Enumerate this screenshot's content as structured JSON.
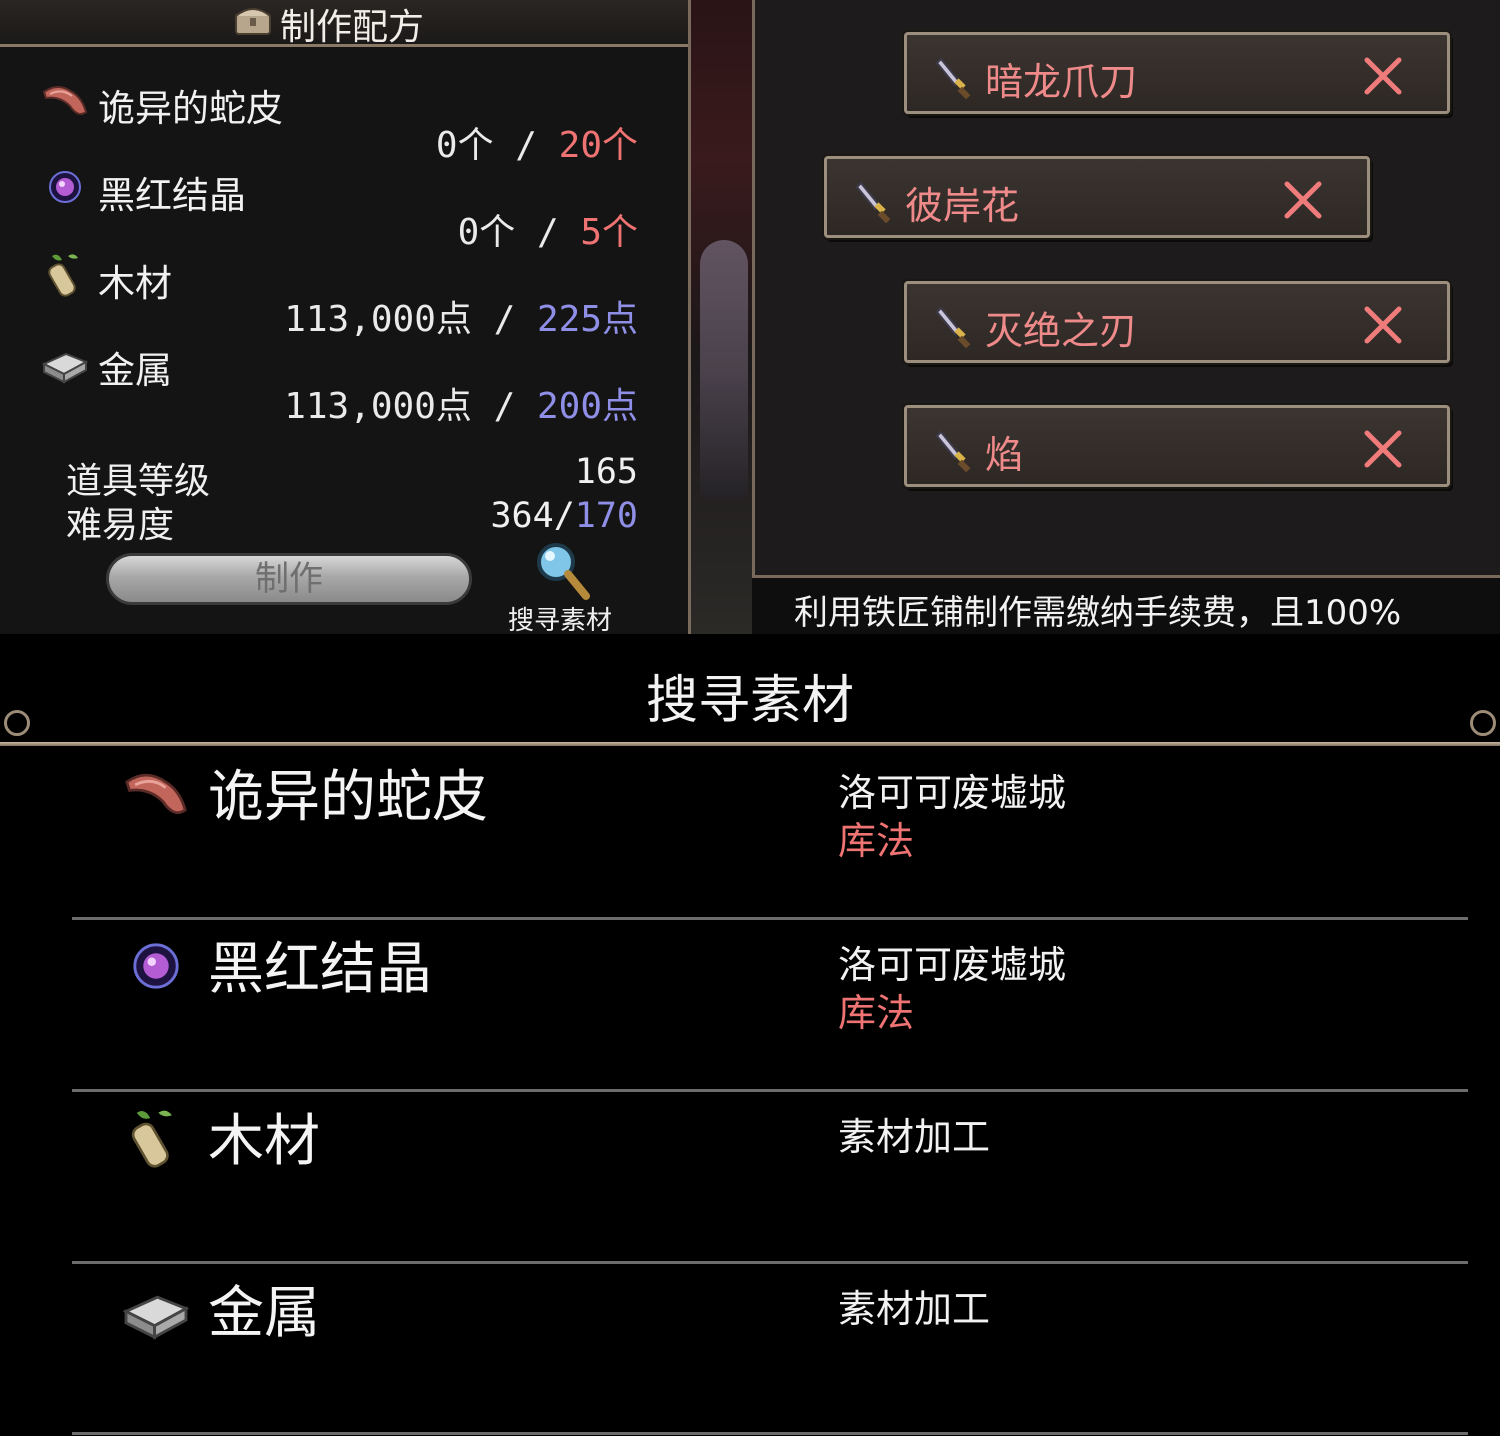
{
  "recipe": {
    "title": "制作配方",
    "materials": [
      {
        "name": "诡异的蛇皮",
        "icon": "snake-skin-icon",
        "have": "0个",
        "sep": "/",
        "need": "20个",
        "need_color": "#ef7373"
      },
      {
        "name": "黑红结晶",
        "icon": "crystal-icon",
        "have": "0个",
        "sep": "/",
        "need": "5个",
        "need_color": "#ef7373"
      },
      {
        "name": "木材",
        "icon": "wood-icon",
        "have": "113,000点",
        "sep": "/",
        "need": "225点",
        "need_color": "#8f8fe8"
      },
      {
        "name": "金属",
        "icon": "metal-icon",
        "have": "113,000点",
        "sep": "/",
        "need": "200点",
        "need_color": "#8f8fe8"
      }
    ],
    "item_level_label": "道具等级",
    "item_level_value": "165",
    "difficulty_label": "难易度",
    "difficulty_have": "364/",
    "difficulty_need": "170",
    "make_button": "制作",
    "search_link": "搜寻素材"
  },
  "weapons": [
    {
      "name": "暗龙爪刀"
    },
    {
      "name": "彼岸花"
    },
    {
      "name": "灭绝之刃"
    },
    {
      "name": "焰"
    }
  ],
  "notice": "利用铁匠铺制作需缴纳手续费，且100%",
  "search": {
    "title": "搜寻素材",
    "rows": [
      {
        "name": "诡异的蛇皮",
        "icon": "snake-skin-icon",
        "location": "洛可可废墟城",
        "sub": "库法"
      },
      {
        "name": "黑红结晶",
        "icon": "crystal-icon",
        "location": "洛可可废墟城",
        "sub": "库法"
      },
      {
        "name": "木材",
        "icon": "wood-icon",
        "location": "素材加工",
        "sub": ""
      },
      {
        "name": "金属",
        "icon": "metal-icon",
        "location": "素材加工",
        "sub": ""
      }
    ]
  },
  "colors": {
    "red": "#ef7373",
    "blue": "#8f8fe8",
    "frame": "#9c8f7e"
  }
}
